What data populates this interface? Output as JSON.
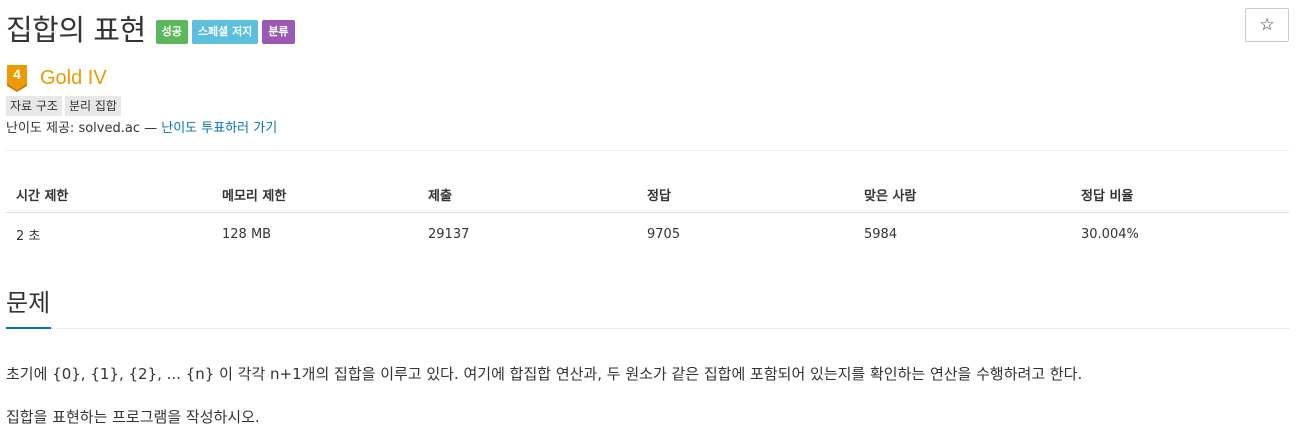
{
  "problem": {
    "title": "집합의 표현",
    "badges": [
      {
        "label": "성공",
        "color": "#5cb85c"
      },
      {
        "label": "스페셜 저지",
        "color": "#5bc0de"
      },
      {
        "label": "분류",
        "color": "#9b59b6"
      }
    ],
    "star_icon": "☆"
  },
  "tier": {
    "number": "4",
    "label": "Gold IV",
    "color": "#ec9a00"
  },
  "tags": [
    "자료 구조",
    "분리 집합"
  ],
  "difficulty": {
    "prefix": "난이도 제공: solved.ac — ",
    "link_text": "난이도 투표하러 가기"
  },
  "stats": {
    "headers": [
      "시간 제한",
      "메모리 제한",
      "제출",
      "정답",
      "맞은 사람",
      "정답 비율"
    ],
    "values": [
      "2 초",
      "128 MB",
      "29137",
      "9705",
      "5984",
      "30.004%"
    ]
  },
  "section": {
    "title": "문제",
    "paragraphs": [
      "초기에 {0}, {1}, {2}, ... {n} 이 각각 n+1개의 집합을 이루고 있다. 여기에 합집합 연산과, 두 원소가 같은 집합에 포함되어 있는지를 확인하는 연산을 수행하려고 한다.",
      "집합을 표현하는 프로그램을 작성하시오."
    ]
  }
}
